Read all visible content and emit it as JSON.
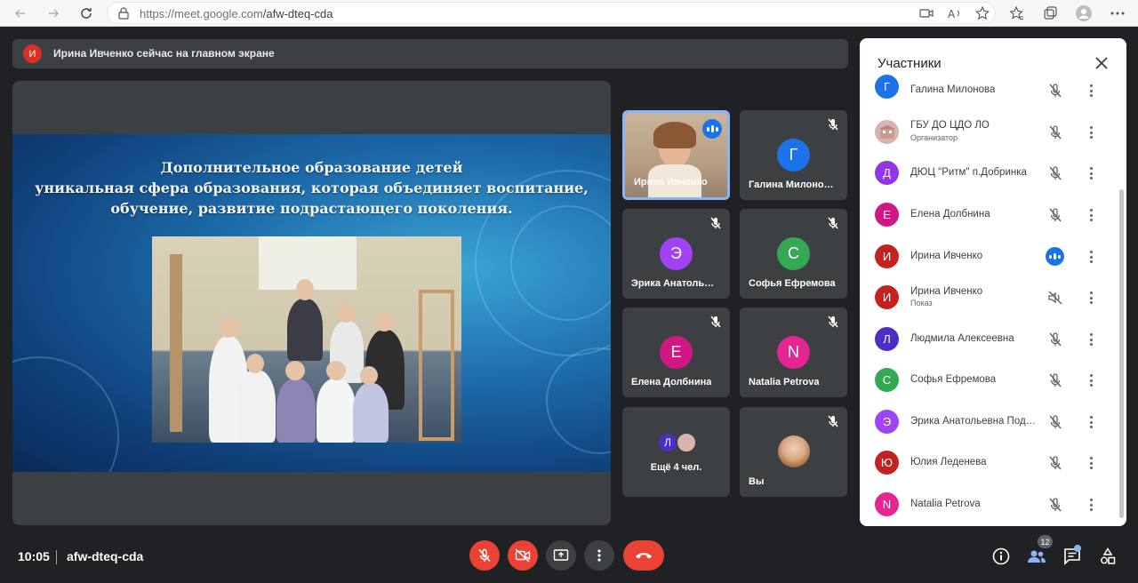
{
  "browser": {
    "url_host": "https://meet.google.com",
    "url_path": "/afw-dteq-cda"
  },
  "banner": {
    "avatar_letter": "И",
    "text": "Ирина Ивченко сейчас на главном экране"
  },
  "slide": {
    "line1": "Дополнительное образование детей",
    "line2": "уникальная сфера образования, которая объединяет воспитание,",
    "line3": "обучение, развитие подрастающего поколения."
  },
  "tiles": [
    {
      "name": "Ирина Ивченко",
      "type": "video",
      "speaking": true
    },
    {
      "name": "Галина Милоно…",
      "letter": "Г",
      "color": "#1a73e8",
      "muted": true
    },
    {
      "name": "Эрика Анатоль…",
      "letter": "Э",
      "color": "#a142f4",
      "muted": true
    },
    {
      "name": "Софья Ефремова",
      "letter": "С",
      "color": "#34a853",
      "muted": true
    },
    {
      "name": "Елена Долбнина",
      "letter": "Е",
      "color": "#d01884",
      "muted": true
    },
    {
      "name": "Natalia Petrova",
      "letter": "N",
      "color": "#e52592",
      "muted": true
    },
    {
      "name": "Ещё 4 чел.",
      "avatar_letter": "Л"
    },
    {
      "name": "Вы",
      "muted": true
    }
  ],
  "panel": {
    "title": "Участники",
    "participants": [
      {
        "letter": "Г",
        "name": "Галина Милонова",
        "color": "#1a73e8",
        "mic": "muted"
      },
      {
        "letter": "",
        "name": "ГБУ ДО ЦДО ЛО",
        "sub": "Организатор",
        "color": "#d8b4b0",
        "mic": "muted"
      },
      {
        "letter": "Д",
        "name": "ДЮЦ \"Ритм\" п.Добринка",
        "color": "#9334e6",
        "mic": "muted"
      },
      {
        "letter": "Е",
        "name": "Елена Долбнина",
        "color": "#d01884",
        "mic": "muted"
      },
      {
        "letter": "И",
        "name": "Ирина Ивченко",
        "color": "#c5221f",
        "mic": "speaking"
      },
      {
        "letter": "И",
        "name": "Ирина Ивченко",
        "sub": "Показ",
        "color": "#c5221f",
        "mic": "presenting"
      },
      {
        "letter": "Л",
        "name": "Людмила Алексеевна",
        "color": "#4b2fc5",
        "mic": "muted"
      },
      {
        "letter": "С",
        "name": "Софья Ефремова",
        "color": "#34a853",
        "mic": "muted"
      },
      {
        "letter": "Э",
        "name": "Эрика Анатольевна Под…",
        "color": "#a142f4",
        "mic": "muted"
      },
      {
        "letter": "Ю",
        "name": "Юлия Леденева",
        "color": "#c5221f",
        "mic": "muted"
      },
      {
        "letter": "N",
        "name": "Natalia Petrova",
        "color": "#e52592",
        "mic": "muted"
      }
    ]
  },
  "bottom": {
    "time": "10:05",
    "meeting_code": "afw-dteq-cda",
    "people_count": "12"
  },
  "colors": {
    "accent_red": "#ea4335",
    "accent_blue": "#1a73e8"
  }
}
